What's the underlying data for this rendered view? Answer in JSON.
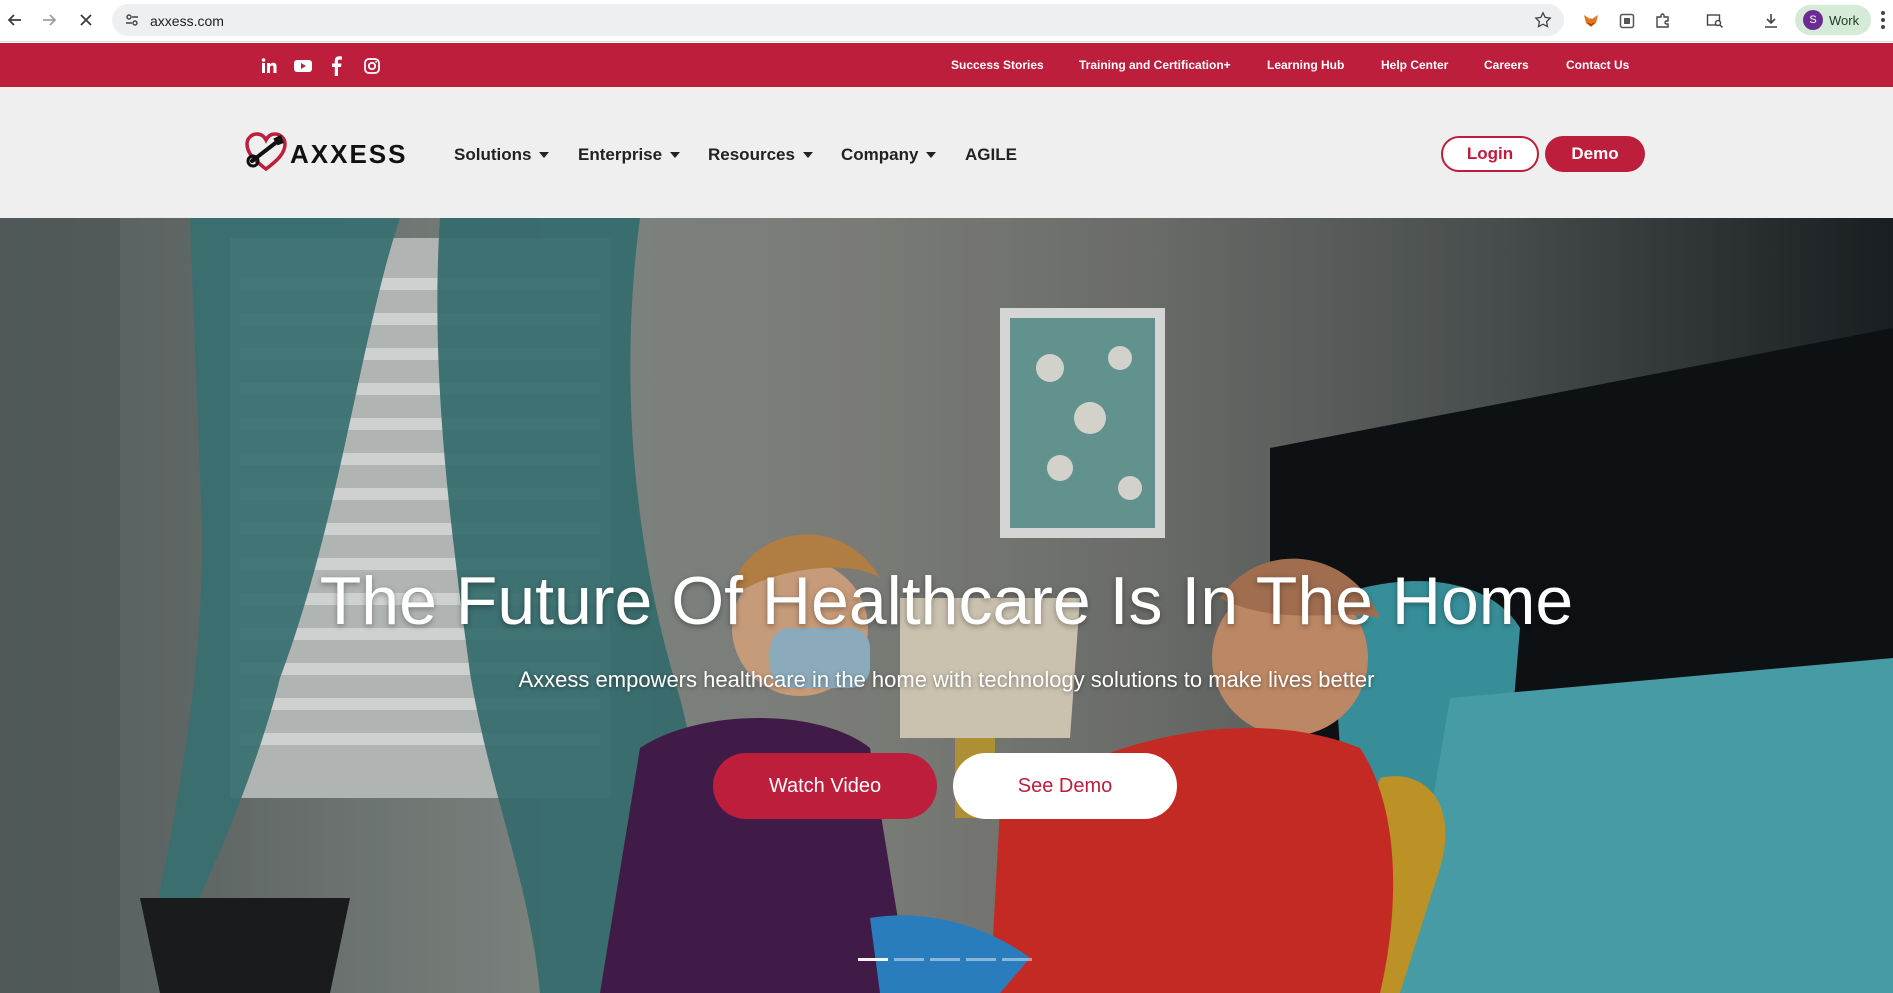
{
  "browser": {
    "url": "axxess.com",
    "profile_initial": "S",
    "profile_label": "Work",
    "icons": [
      "back-arrow-icon",
      "forward-arrow-icon",
      "stop-icon",
      "site-settings-icon",
      "bookmark-star-icon",
      "metamask-fox-icon",
      "extension-icon",
      "puzzle-extensions-icon",
      "tab-search-icon",
      "download-icon",
      "kebab-menu-icon"
    ]
  },
  "topbar": {
    "social": [
      "linkedin-icon",
      "youtube-icon",
      "facebook-icon",
      "instagram-icon"
    ],
    "links": [
      "Success Stories",
      "Training and Certification+",
      "Learning Hub",
      "Help Center",
      "Careers",
      "Contact Us"
    ]
  },
  "header": {
    "logo_text": "AXXESS",
    "menu": [
      "Solutions",
      "Enterprise",
      "Resources",
      "Company",
      "AGILE"
    ],
    "login_label": "Login",
    "demo_label": "Demo"
  },
  "hero": {
    "title": "The Future Of Healthcare Is In The Home",
    "subtitle": "Axxess empowers healthcare in the home with technology solutions to make lives better",
    "watch_label": "Watch Video",
    "see_demo_label": "See Demo",
    "slide_count": 5,
    "active_slide": 1
  },
  "colors": {
    "brand_red": "#bc1e3b",
    "header_bg": "#efefef"
  }
}
